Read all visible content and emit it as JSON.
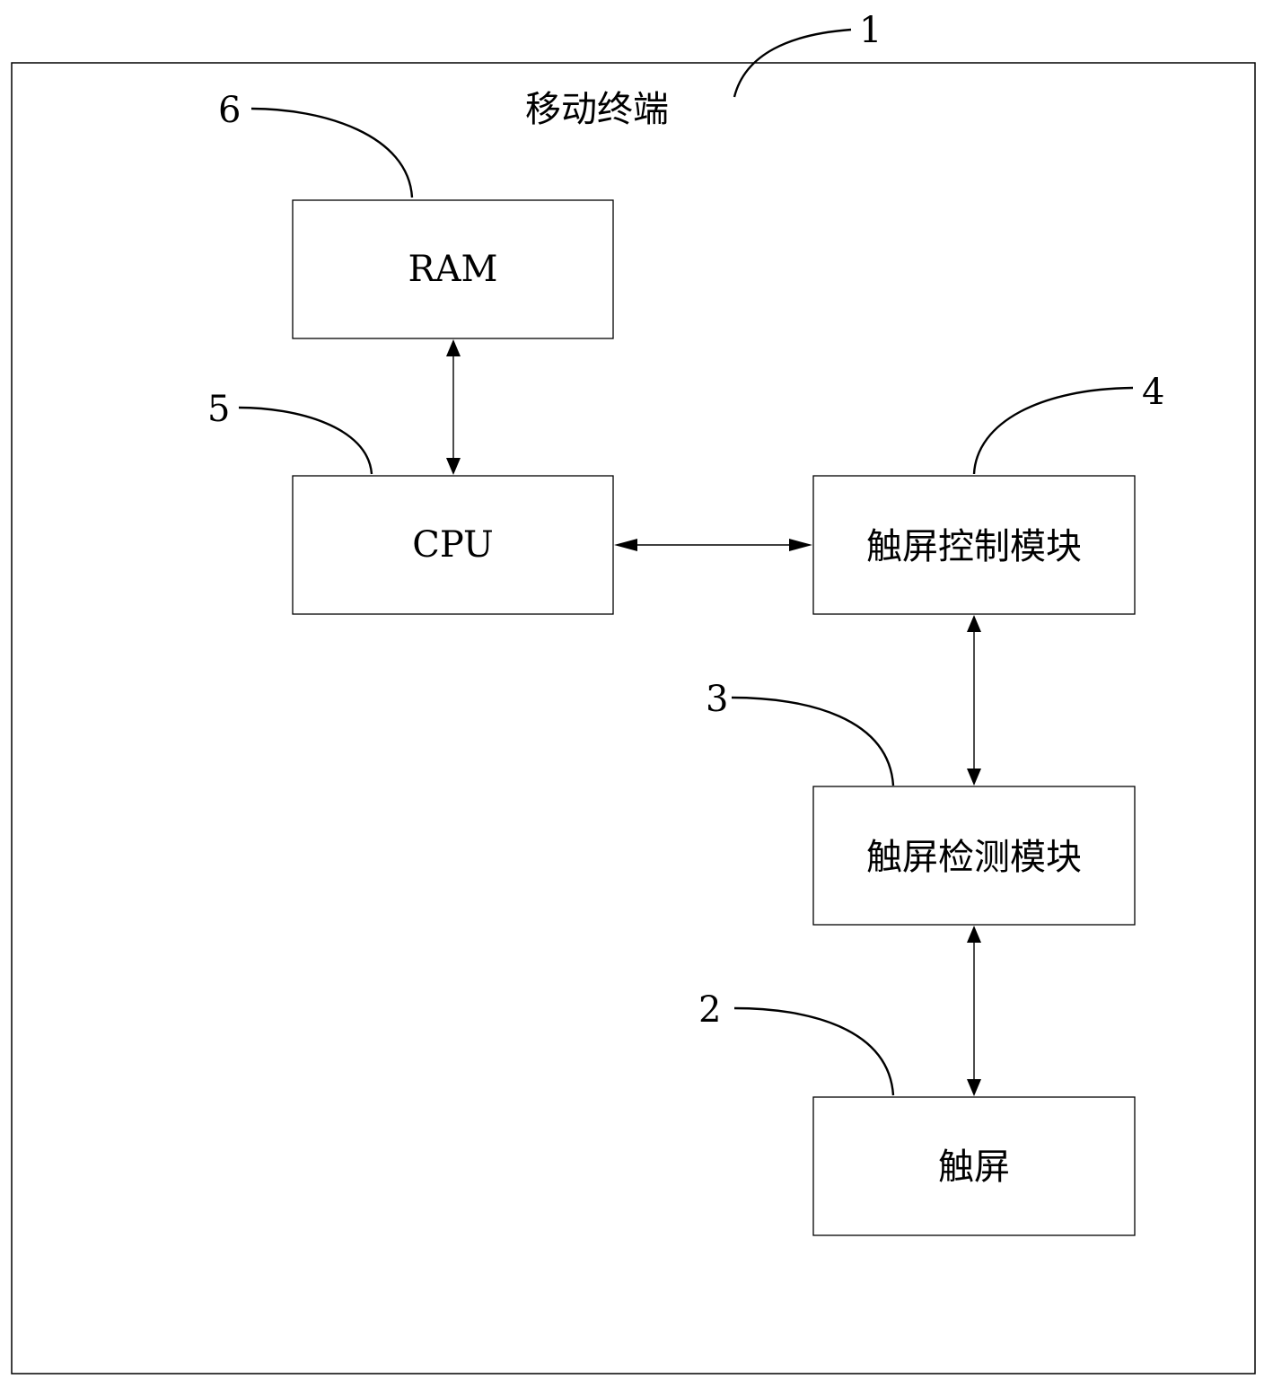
{
  "diagram": {
    "title": "移动终端",
    "title_ref": "1",
    "colors": {
      "stroke": "#000000",
      "background": "#ffffff"
    },
    "nodes": [
      {
        "id": "ram",
        "label": "RAM",
        "ref": "6"
      },
      {
        "id": "cpu",
        "label": "CPU",
        "ref": "5"
      },
      {
        "id": "touch_control",
        "label": "触屏控制模块",
        "ref": "4"
      },
      {
        "id": "touch_detect",
        "label": "触屏检测模块",
        "ref": "3"
      },
      {
        "id": "touchscreen",
        "label": "触屏",
        "ref": "2"
      }
    ],
    "edges": [
      {
        "from": "ram",
        "to": "cpu",
        "direction": "bidirectional"
      },
      {
        "from": "cpu",
        "to": "touch_control",
        "direction": "bidirectional"
      },
      {
        "from": "touch_control",
        "to": "touch_detect",
        "direction": "bidirectional"
      },
      {
        "from": "touch_detect",
        "to": "touchscreen",
        "direction": "bidirectional"
      }
    ]
  }
}
